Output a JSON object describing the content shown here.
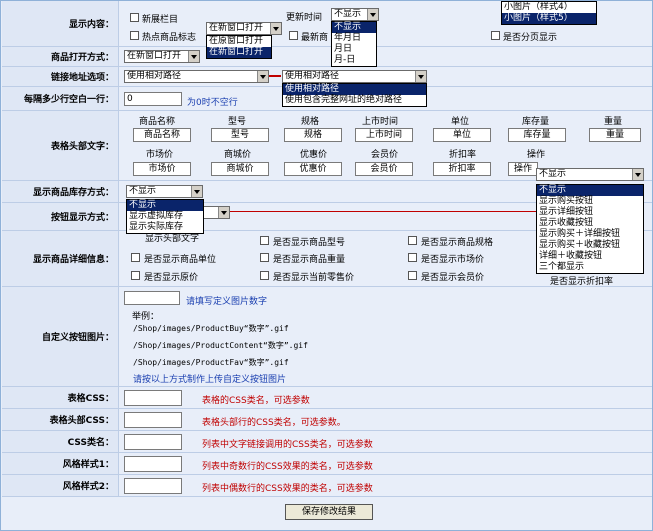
{
  "top_dropdown": {
    "options": [
      "小图片（样式4）",
      "小图片（样式5）"
    ]
  },
  "display": {
    "label": "显示内容：",
    "new_column": "新展栏目",
    "hot_flag": "热点商品标志",
    "newest": "最新商",
    "open_select": "在新窗口打开",
    "open_options": [
      "在原窗口打开",
      "在新窗口打开"
    ],
    "update_time": "更新时间",
    "time_select": "不显示",
    "time_options": [
      "不显示",
      "年月日",
      "月日",
      "月-日"
    ],
    "paging": "是否分页显示"
  },
  "open_mode": {
    "label": "商品打开方式：",
    "select": "在新窗口打开"
  },
  "link": {
    "label": "链接地址选项：",
    "select": "使用相对路径",
    "select2": "使用相对路径",
    "options": [
      "使用相对路径",
      "使用包含完整网址的绝对路径"
    ]
  },
  "per_row": {
    "label": "每隔多少行空白一行：",
    "value": "0",
    "hint": "为0时不空行"
  },
  "header_text": {
    "label": "表格头部文字：",
    "row1": [
      "商品名称",
      "型号",
      "规格",
      "上市时间",
      "单位",
      "库存量",
      "重量"
    ],
    "row2": [
      "市场价",
      "商城价",
      "优惠价",
      "会员价",
      "折扣率",
      "操作"
    ]
  },
  "stock": {
    "label": "显示商品库存方式：",
    "select": "不显示",
    "options": [
      "不显示",
      "显示虚拟库存",
      "显示实际库存"
    ]
  },
  "button_mode": {
    "label": "按钮显示方式：",
    "select": "不显示",
    "options": [
      "不显示",
      "显示购买按钮",
      "显示详细按钮",
      "显示收藏按钮",
      "显示购买＋详细按钮",
      "显示购买＋收藏按钮",
      "详细＋收藏按钮",
      "三个都显示"
    ]
  },
  "detail": {
    "label": "显示商品详细信息：",
    "items": [
      "是否显示商品型号",
      "是否显示商品规格",
      "是否显示商品单位",
      "是否显示商品重量",
      "是否显示市场价",
      "是否显示原价",
      "是否显示当前零售价",
      "是否显示会员价"
    ],
    "partial": [
      "显示头部文字",
      "是否显示折扣率"
    ]
  },
  "custom_btn": {
    "label": "自定义按钮图片：",
    "hint": "请填写定义图片数字",
    "example": "举例：",
    "paths": [
      "/Shop/images/ProductBuy“数字”.gif",
      "/Shop/images/ProductContent“数字”.gif",
      "/Shop/images/ProductFav“数字”.gif"
    ],
    "note": "请按以上方式制作上传自定义按钮图片"
  },
  "css_rows": [
    {
      "label": "表格CSS：",
      "hint": "表格的CSS类名，可选参数"
    },
    {
      "label": "表格头部CSS：",
      "hint": "表格头部行的CSS类名，可选参数。"
    },
    {
      "label": "CSS类名：",
      "hint": "列表中文字链接调用的CSS类名，可选参数"
    },
    {
      "label": "风格样式1：",
      "hint": "列表中奇数行的CSS效果的类名，可选参数"
    },
    {
      "label": "风格样式2：",
      "hint": "列表中偶数行的CSS效果的类名，可选参数"
    }
  ],
  "submit": "保存修改结果"
}
